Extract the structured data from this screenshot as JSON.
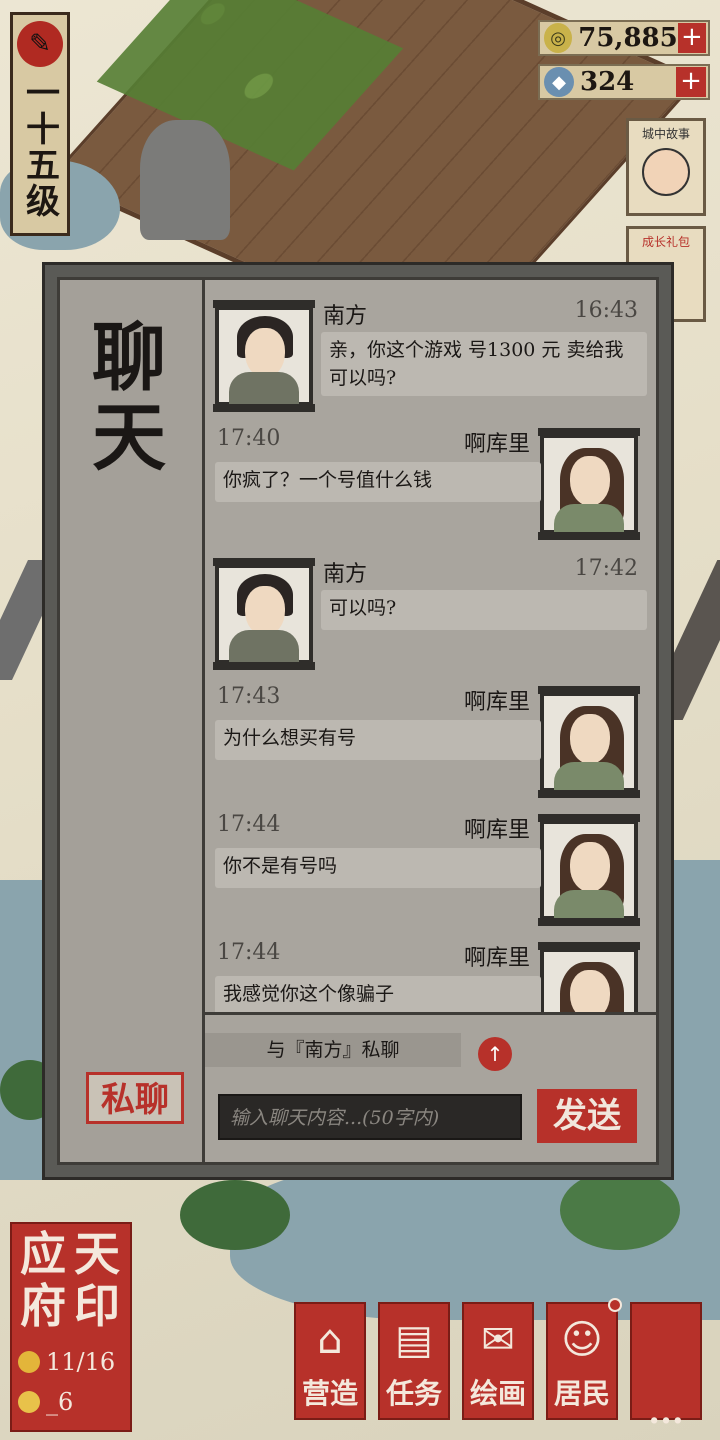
{
  "hud": {
    "level": "一十五级",
    "coins": "75,885",
    "gems": "324",
    "plus": "+"
  },
  "side_cards": {
    "story": "城中故事",
    "gift": "成长礼包"
  },
  "chat": {
    "title": "聊天",
    "private_tab": "私聊",
    "messages": [
      {
        "sender": "南方",
        "time": "16:43",
        "text": "亲，你这个游戏 号1300 元 卖给我可以吗?",
        "side": "left"
      },
      {
        "sender": "啊库里",
        "time": "17:40",
        "text": "你疯了？一个号值什么钱",
        "side": "right"
      },
      {
        "sender": "南方",
        "time": "17:42",
        "text": "可以吗?",
        "side": "left"
      },
      {
        "sender": "啊库里",
        "time": "17:43",
        "text": "为什么想买有号",
        "side": "right"
      },
      {
        "sender": "啊库里",
        "time": "17:44",
        "text": "你不是有号吗",
        "side": "right"
      },
      {
        "sender": "啊库里",
        "time": "17:44",
        "text": "我感觉你这个像骗子",
        "side": "right"
      }
    ],
    "private_target": "与『南方』私聊",
    "input_placeholder": "输入聊天内容...(50字内)",
    "send_label": "发送"
  },
  "city": {
    "name": "应天府印",
    "name_chars": [
      "应",
      "天",
      "府",
      "印"
    ],
    "population": "11/16",
    "other": "_6"
  },
  "nav": [
    {
      "label": "营造",
      "icon": "building-icon"
    },
    {
      "label": "任务",
      "icon": "scroll-book-icon"
    },
    {
      "label": "绘画",
      "icon": "painting-scroll-icon"
    },
    {
      "label": "居民",
      "icon": "resident-icon"
    },
    {
      "label": "...",
      "icon": "more-icon"
    }
  ]
}
